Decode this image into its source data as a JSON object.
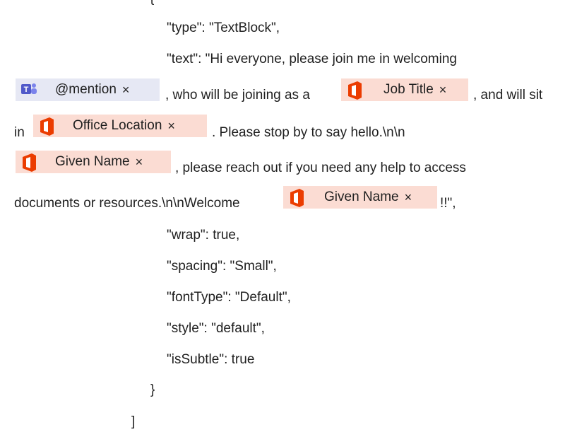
{
  "code": {
    "line_open_brace": "{",
    "line_type": "\"type\": \"TextBlock\",",
    "line_text_start": "\"text\": \"Hi everyone, please join me in welcoming",
    "seg_after_mention": ", who will be joining as a",
    "seg_after_jobtitle": ", and will sit",
    "seg_in": "in",
    "seg_after_office": ". Please stop by to say hello.\\n\\n",
    "seg_after_given1": ", please reach out if you need any help to access",
    "seg_docs": "documents or resources.\\n\\nWelcome",
    "seg_end": "!!\",",
    "line_wrap": "\"wrap\": true,",
    "line_spacing": "\"spacing\": \"Small\",",
    "line_fonttype": "\"fontType\": \"Default\",",
    "line_style": "\"style\": \"default\",",
    "line_issubtle": "\"isSubtle\": true",
    "line_close_brace": "}",
    "line_close_bracket": "]"
  },
  "tokens": {
    "mention": {
      "label": "@mention",
      "close": "×",
      "icon": "teams-icon"
    },
    "job_title": {
      "label": "Job Title",
      "close": "×",
      "icon": "office-icon"
    },
    "office_location": {
      "label": "Office Location",
      "close": "×",
      "icon": "office-icon"
    },
    "given_name_1": {
      "label": "Given Name",
      "close": "×",
      "icon": "office-icon"
    },
    "given_name_2": {
      "label": "Given Name",
      "close": "×",
      "icon": "office-icon"
    }
  },
  "colors": {
    "teams_chip": "#e6e8f4",
    "office_chip": "#fbdcd3",
    "office_red": "#eb3c00",
    "teams_purple": "#5059c9"
  }
}
